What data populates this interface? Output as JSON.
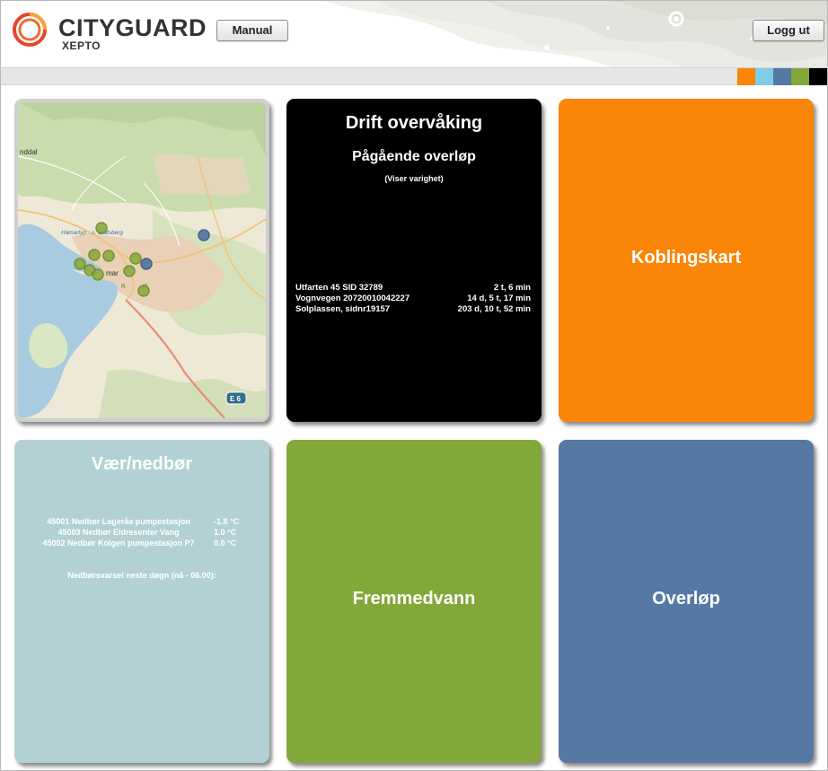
{
  "header": {
    "brand": "CITYGUARD",
    "brand_sub": "XEPTO",
    "manual_label": "Manual",
    "logout_label": "Logg ut",
    "swatch_colors": [
      "#fb8507",
      "#7fcde8",
      "#5679a4",
      "#82a83a",
      "#000000"
    ]
  },
  "map": {
    "labels": {
      "town_left": "nddal",
      "place_a": "Hamarlyp…s. Stafsberg",
      "place_b": "mar",
      "road_a": "R",
      "road_b": "R",
      "road_shield": "E 6"
    }
  },
  "drift": {
    "title": "Drift overvåking",
    "subtitle": "Pågående overløp",
    "note": "(Viser varighet)",
    "items": [
      {
        "name": "Utfarten 45 SID 32789",
        "duration": "2 t, 6 min"
      },
      {
        "name": "Vognvegen 20720010042227",
        "duration": "14 d, 5 t, 17 min"
      },
      {
        "name": "Solplassen, sidnr19157",
        "duration": "203 d, 10 t, 52 min"
      }
    ]
  },
  "koblingskart": {
    "title": "Koblingskart"
  },
  "weather": {
    "title": "Vær/nedbør",
    "stations": [
      {
        "name": "45001 Nedbør Lageråa pumpestasjon",
        "value": "-1.8 °C"
      },
      {
        "name": "45003 Nedbør Eldresenter Vang",
        "value": "1.0 °C"
      },
      {
        "name": "45002 Nedbør Koigen pumpestasjon P7",
        "value": "0.0 °C"
      }
    ],
    "forecast_label": "Nedbørsvarsel neste døgn (nå - 06.00):"
  },
  "fremmedvann": {
    "title": "Fremmedvann"
  },
  "overlop": {
    "title": "Overløp"
  }
}
